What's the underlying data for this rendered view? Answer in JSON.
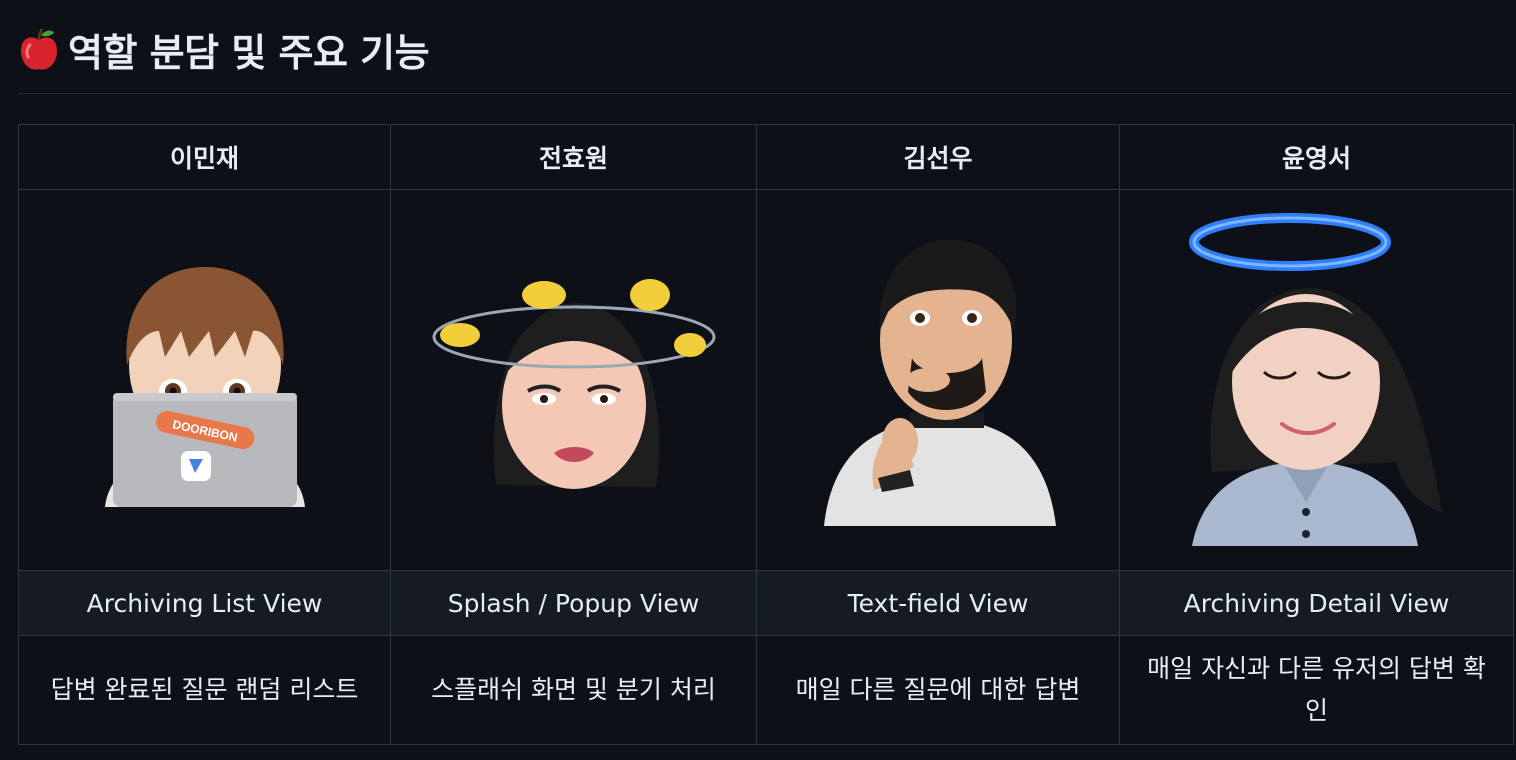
{
  "section": {
    "icon": "apple-icon",
    "title": "역할 분담 및 주요 기능"
  },
  "members": [
    {
      "name": "이민재",
      "avatar": "memoji-laptop",
      "view": "Archiving List View",
      "description": "답변 완료된 질문 랜덤 리스트"
    },
    {
      "name": "전효원",
      "avatar": "memoji-birds",
      "view": "Splash / Popup View",
      "description": "스플래쉬 화면 및 분기 처리"
    },
    {
      "name": "김선우",
      "avatar": "memoji-finger-heart",
      "view": "Text-field View",
      "description": "매일 다른 질문에 대한 답변"
    },
    {
      "name": "윤영서",
      "avatar": "memoji-halo",
      "view": "Archiving Detail View",
      "description": "매일 자신과 다른 유저의 답변 확인"
    }
  ],
  "laptop_sticker": "DOORIBON",
  "colors": {
    "background": "#0d1117",
    "border": "#30363d",
    "row_alt": "#161b22",
    "text": "#e6edf3"
  }
}
